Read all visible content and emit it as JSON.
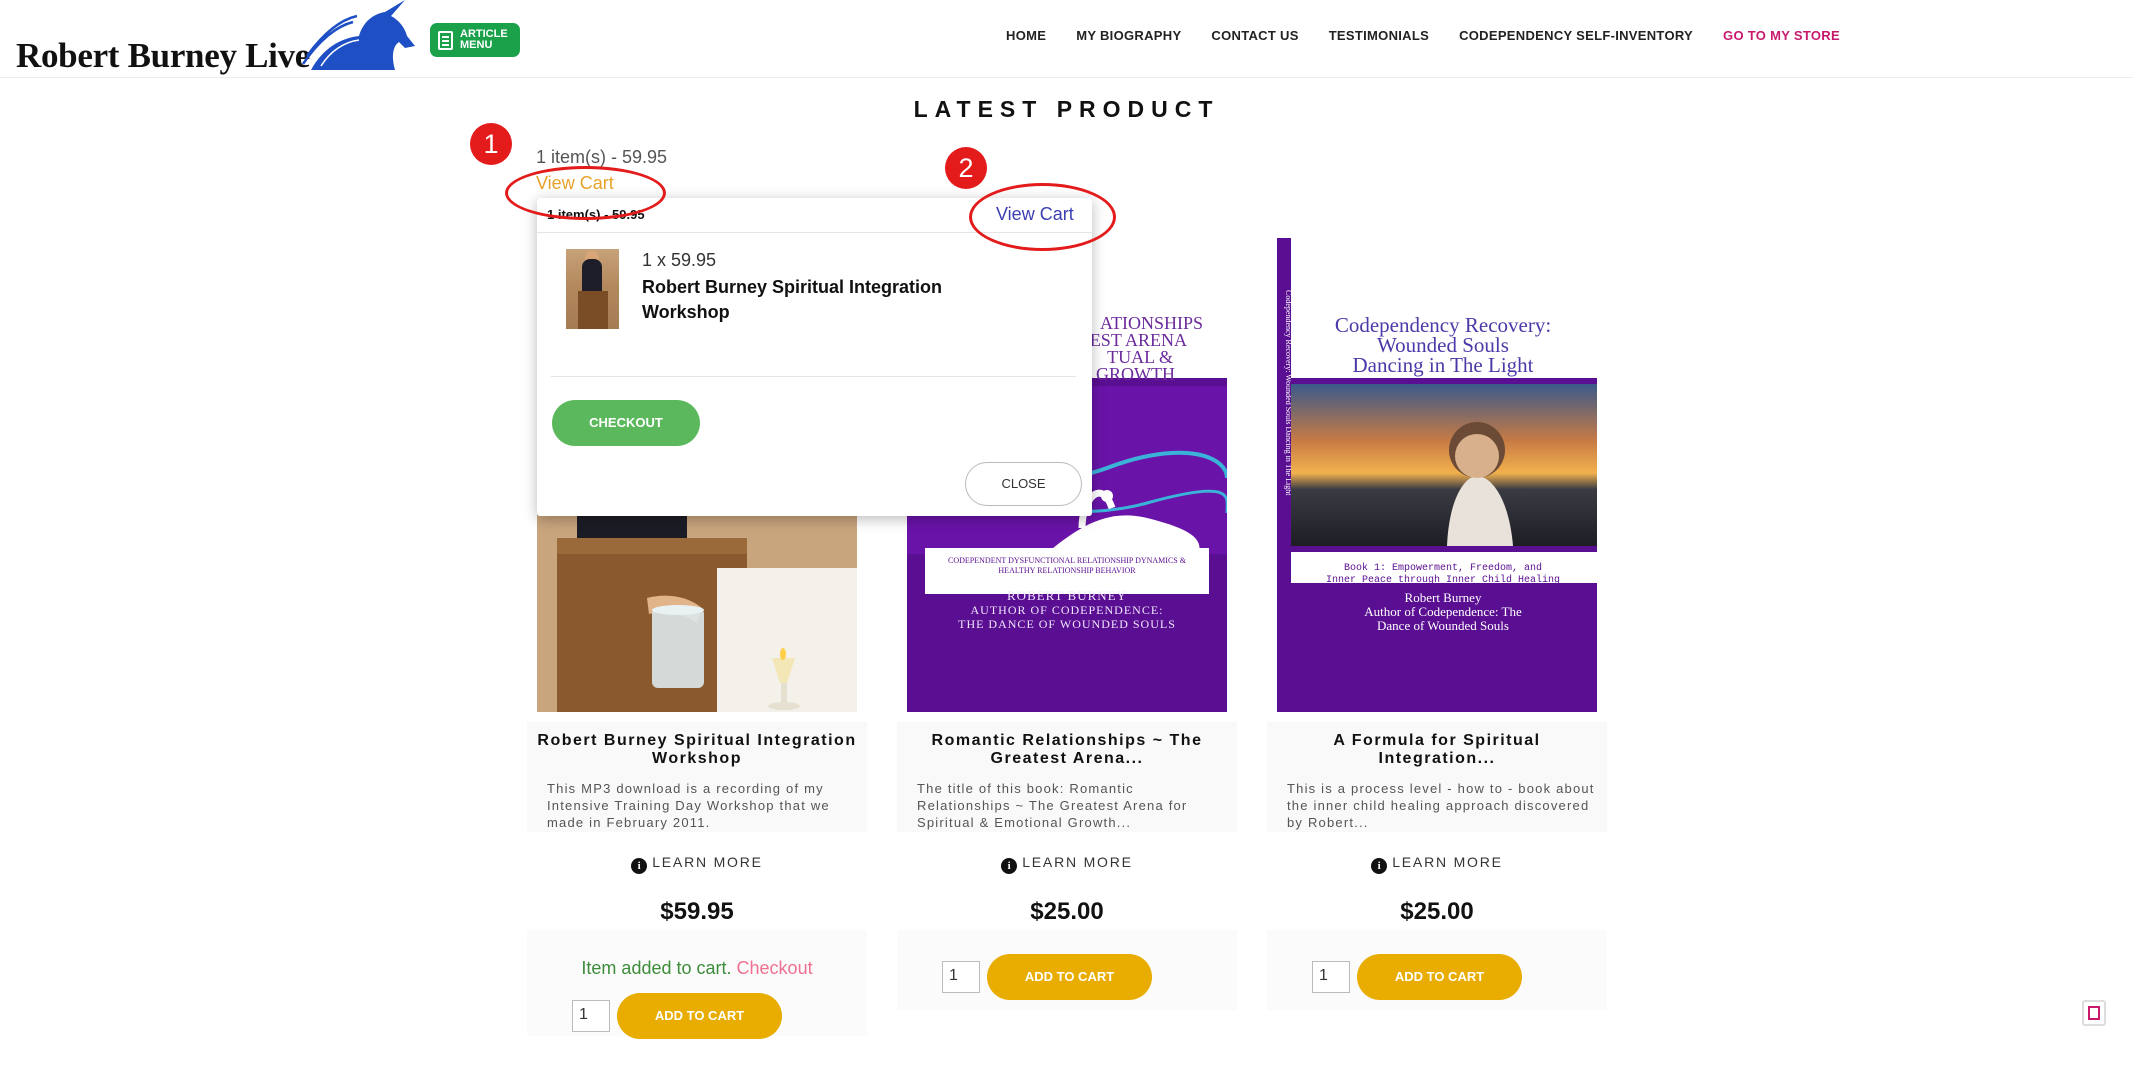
{
  "brand": {
    "logo_text": "Robert Burney Live",
    "article_line1": "ARTICLE",
    "article_line2": "MENU"
  },
  "nav": [
    {
      "label": "HOME"
    },
    {
      "label": "MY BIOGRAPHY"
    },
    {
      "label": "CONTACT US"
    },
    {
      "label": "TESTIMONIALS"
    },
    {
      "label": "CODEPENDENCY SELF-INVENTORY"
    },
    {
      "label": "GO TO MY STORE"
    }
  ],
  "section_title": "LATEST PRODUCT",
  "cart_summary": {
    "text": "1 item(s) - 59.95",
    "view_cart": "View Cart"
  },
  "annotations": {
    "marker1": "1",
    "marker2": "2"
  },
  "mini_cart": {
    "header": "1 item(s) - 59.95",
    "view_cart": "View Cart",
    "item_qty_price": "1 x 59.95",
    "item_name": "Robert Burney Spiritual Integration Workshop",
    "checkout": "CHECKOUT",
    "close": "CLOSE"
  },
  "products": [
    {
      "title": "Robert Burney Spiritual Integration Workshop",
      "desc": "This MP3 download is a recording of my Intensive Training Day Workshop that we made in February 2011.",
      "learn_more": "LEARN MORE",
      "price": "$59.95",
      "added_text": "Item added to cart.",
      "added_link": "Checkout",
      "qty": "1",
      "add_label": "ADD TO CART"
    },
    {
      "title": "Romantic Relationships ~ The Greatest Arena...",
      "desc": "The title of this book: Romantic Relationships ~ The Greatest Arena for Spiritual & Emotional Growth...",
      "learn_more": "LEARN MORE",
      "price": "$25.00",
      "qty": "1",
      "add_label": "ADD TO CART",
      "cover": {
        "title_l1": "ATIONSHIPS",
        "title_l2": "EST ARENA",
        "title_l3": "TUAL &",
        "title_l4": "GROWTH",
        "band1": "CODEPENDENT DYSFUNCTIONAL RELATIONSHIP DYNAMICS &",
        "band2": "HEALTHY RELATIONSHIP BEHAVIOR",
        "author1": "ROBERT BURNEY",
        "author2": "AUTHOR OF CODEPENDENCE:",
        "author3": "THE DANCE OF WOUNDED SOULS"
      }
    },
    {
      "title": "A Formula for Spiritual Integration...",
      "desc": "This is a process level - how to - book about the inner child healing approach discovered by Robert...",
      "learn_more": "LEARN MORE",
      "price": "$25.00",
      "qty": "1",
      "add_label": "ADD TO CART",
      "cover": {
        "title_l1": "Codependency Recovery:",
        "title_l2": "Wounded Souls",
        "title_l3": "Dancing in The Light",
        "spine": "Codependency Recovery: Wounded Souls Dancing in The Light",
        "sub1": "Book 1: Empowerment, Freedom, and",
        "sub2": "Inner Peace through Inner Child Healing",
        "author1": "Robert Burney",
        "author2": "Author of Codependence: The",
        "author3": "Dance of Wounded Souls"
      }
    }
  ],
  "colors": {
    "accent_pink": "#c8196d",
    "add_btn": "#e8ad00",
    "checkout_green": "#5cb85c",
    "annotation_red": "#e31b1b",
    "cover_purple": "#5a0e91"
  }
}
